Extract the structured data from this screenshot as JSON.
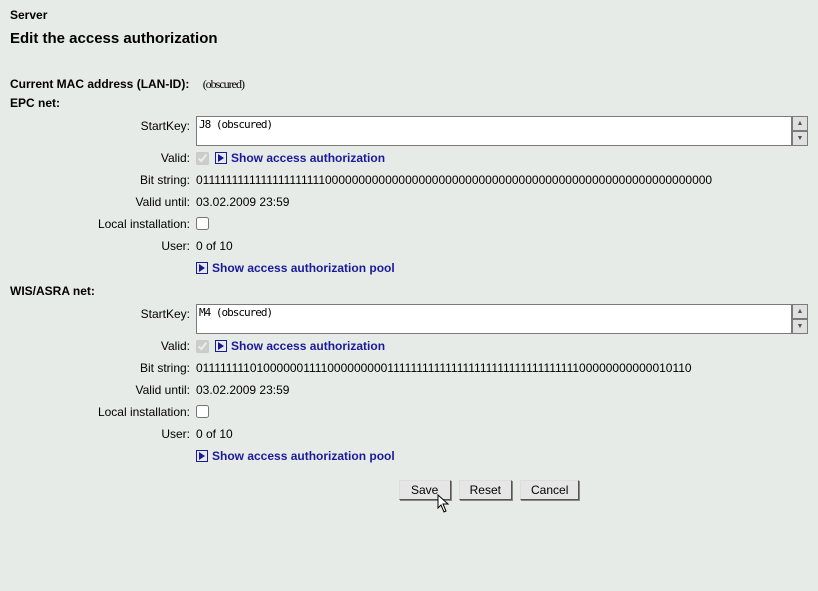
{
  "header": {
    "server": "Server",
    "title": "Edit the access authorization"
  },
  "mac": {
    "label": "Current MAC address (LAN-ID):",
    "value": "(obscured)"
  },
  "labels": {
    "startkey": "StartKey:",
    "valid": "Valid:",
    "bitstring": "Bit string:",
    "valid_until": "Valid until:",
    "local_install": "Local installation:",
    "user": "User:"
  },
  "links": {
    "show_auth": "Show access authorization",
    "show_pool": "Show access authorization pool"
  },
  "epc": {
    "head": "EPC net:",
    "startkey": "J8 (obscured)",
    "valid": true,
    "bitstring": "01111111111111111111110000000000000000000000000000000000000000000000000000000000",
    "valid_until": "03.02.2009 23:59",
    "local_install": false,
    "user": "0 of 10"
  },
  "wis": {
    "head": "WIS/ASRA net:",
    "startkey": "M4 (obscured)",
    "valid": true,
    "bitstring": "01111111101000000111100000000011111111111111111111111111111111100000000000010110",
    "valid_until": "03.02.2009 23:59",
    "local_install": false,
    "user": "0 of 10"
  },
  "buttons": {
    "save": "Save",
    "reset": "Reset",
    "cancel": "Cancel"
  }
}
